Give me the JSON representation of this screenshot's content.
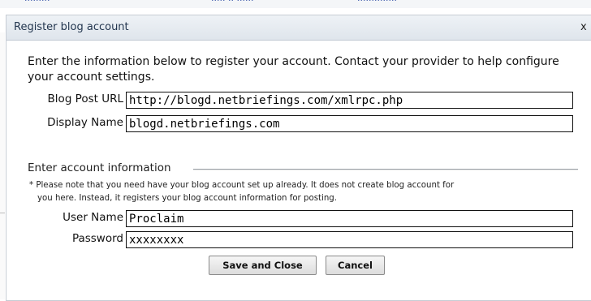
{
  "dialog": {
    "title": "Register blog account",
    "close_glyph": "x"
  },
  "intro_text": "Enter the information below to register your account. Contact your provider to help configure your account settings.",
  "blog_fields": {
    "post_url_label": "Blog Post URL",
    "post_url_value": "http://blogd.netbriefings.com/xmlrpc.php",
    "display_name_label": "Display Name",
    "display_name_value": "blogd.netbriefings.com"
  },
  "account_section": {
    "legend": "Enter account information",
    "note_line1": "* Please note that you need have your blog account set up already. It does not create blog account for",
    "note_line2": "you here. Instead, it registers your blog account information for posting.",
    "user_name_label": "User Name",
    "user_name_value": "Proclaim",
    "password_label": "Password",
    "password_value": "xxxxxxxx"
  },
  "buttons": {
    "save_close": "Save and Close",
    "cancel": "Cancel"
  }
}
